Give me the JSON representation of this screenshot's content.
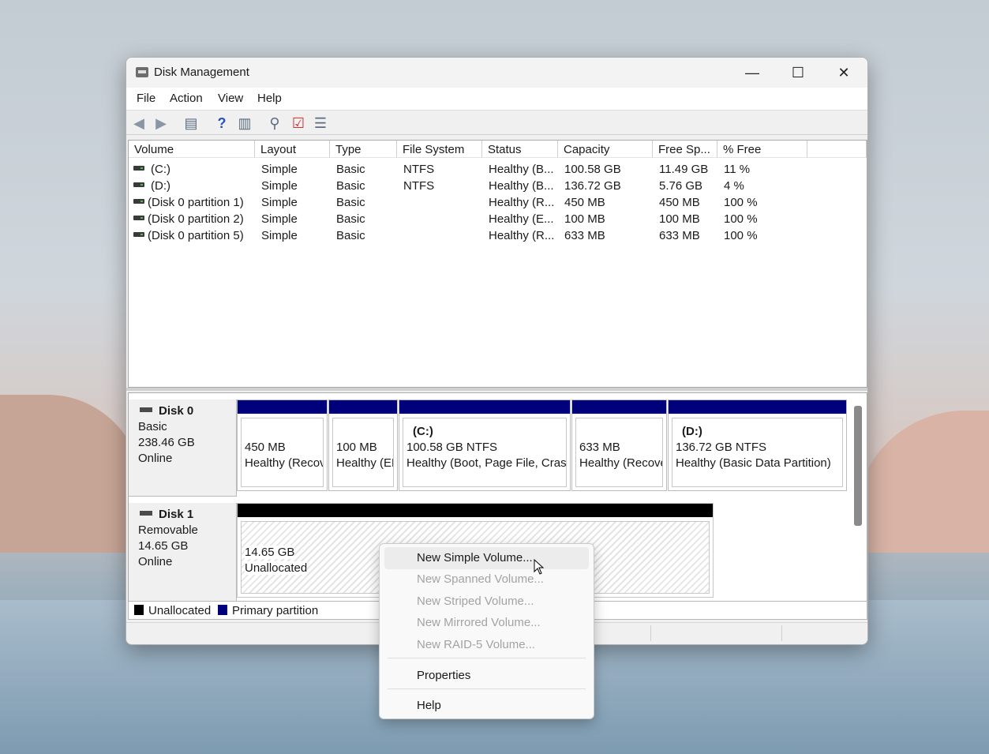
{
  "window": {
    "title": "Disk Management",
    "controls": {
      "minimize": "—",
      "maximize": "☐",
      "close": "✕"
    }
  },
  "menu": [
    "File",
    "Action",
    "View",
    "Help"
  ],
  "toolbar_icons": [
    "back-arrow-icon",
    "forward-arrow-icon",
    "console-tree-icon",
    "help-icon",
    "action-pane-icon",
    "rescan-icon",
    "checklist-icon",
    "properties-icon"
  ],
  "table": {
    "columns": [
      "Volume",
      "Layout",
      "Type",
      "File System",
      "Status",
      "Capacity",
      "Free Sp...",
      "% Free"
    ],
    "rows": [
      [
        "(C:)",
        "Simple",
        "Basic",
        "NTFS",
        "Healthy (B...",
        "100.58 GB",
        "11.49 GB",
        "11 %"
      ],
      [
        "(D:)",
        "Simple",
        "Basic",
        "NTFS",
        "Healthy (B...",
        "136.72 GB",
        "5.76 GB",
        "4 %"
      ],
      [
        "(Disk 0 partition 1)",
        "Simple",
        "Basic",
        "",
        "Healthy (R...",
        "450 MB",
        "450 MB",
        "100 %"
      ],
      [
        "(Disk 0 partition 2)",
        "Simple",
        "Basic",
        "",
        "Healthy (E...",
        "100 MB",
        "100 MB",
        "100 %"
      ],
      [
        "(Disk 0 partition 5)",
        "Simple",
        "Basic",
        "",
        "Healthy (R...",
        "633 MB",
        "633 MB",
        "100 %"
      ]
    ]
  },
  "disks": [
    {
      "name": "Disk 0",
      "type": "Basic",
      "size": "238.46 GB",
      "state": "Online",
      "partitions": [
        {
          "label": "",
          "size": "450 MB",
          "status": "Healthy (Recovery Partition)"
        },
        {
          "label": "",
          "size": "100 MB",
          "status": "Healthy (EFI System Partition)"
        },
        {
          "label": "(C:)",
          "size": "100.58 GB NTFS",
          "status": "Healthy (Boot, Page File, Crash Dump, Basic Data Partition)"
        },
        {
          "label": "",
          "size": "633 MB",
          "status": "Healthy (Recovery Partition)"
        },
        {
          "label": "(D:)",
          "size": "136.72 GB NTFS",
          "status": "Healthy (Basic Data Partition)"
        }
      ]
    },
    {
      "name": "Disk 1",
      "type": "Removable",
      "size": "14.65 GB",
      "state": "Online",
      "partitions": [
        {
          "size": "14.65 GB",
          "status": "Unallocated"
        }
      ]
    }
  ],
  "legend": [
    {
      "label": "Unallocated",
      "color": "#000000"
    },
    {
      "label": "Primary partition",
      "color": "#00007d"
    }
  ],
  "context_menu": {
    "items": [
      {
        "label": "New Simple Volume...",
        "enabled": true
      },
      {
        "label": "New Spanned Volume...",
        "enabled": false
      },
      {
        "label": "New Striped Volume...",
        "enabled": false
      },
      {
        "label": "New Mirrored Volume...",
        "enabled": false
      },
      {
        "label": "New RAID-5 Volume...",
        "enabled": false
      },
      {
        "label": "Properties",
        "enabled": true
      },
      {
        "label": "Help",
        "enabled": true
      }
    ]
  }
}
